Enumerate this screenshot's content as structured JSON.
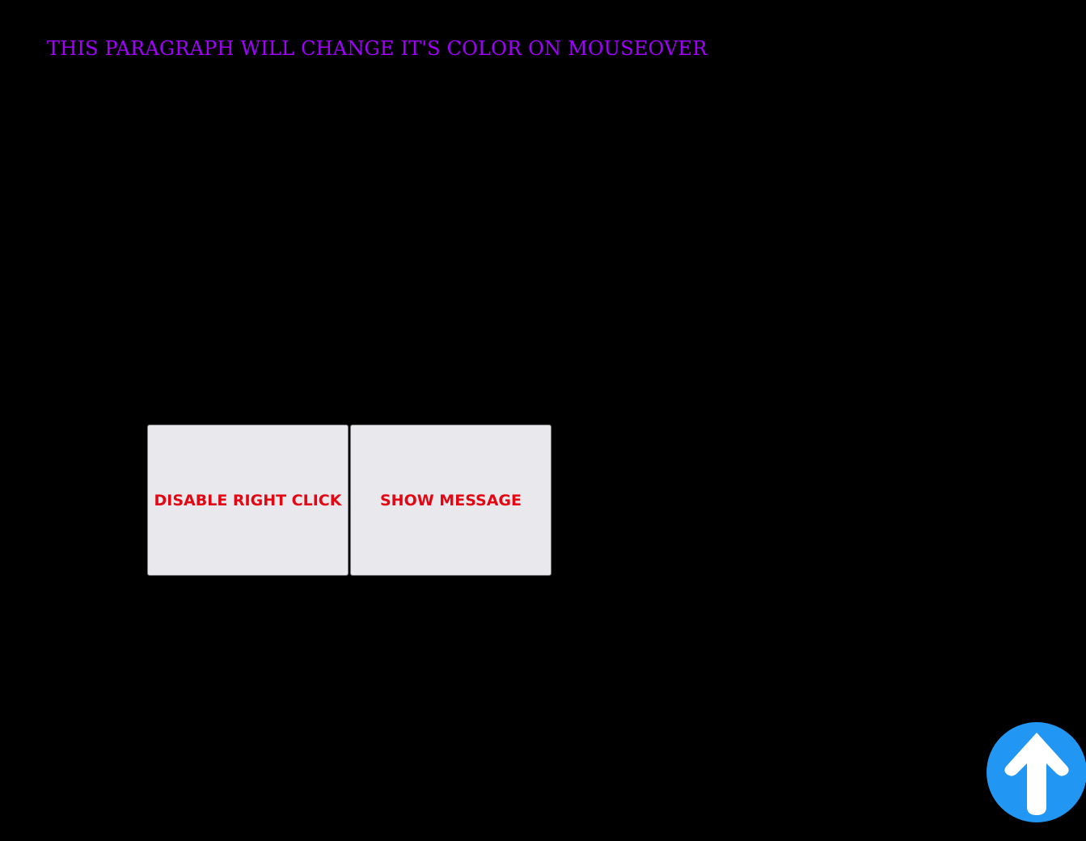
{
  "paragraph": {
    "text": "THIS PARAGRAPH WILL CHANGE IT'S COLOR ON MOUSEOVER",
    "color": "#a100ff"
  },
  "buttons": {
    "disable_right_click_label": "DISABLE RIGHT CLICK",
    "show_message_label": "SHOW MESSAGE",
    "label_color": "#e30613",
    "background_color": "#e9e8ec"
  },
  "scroll_top": {
    "icon": "arrow-up-icon",
    "color": "#2196f3"
  },
  "page": {
    "background_color": "#000000"
  }
}
